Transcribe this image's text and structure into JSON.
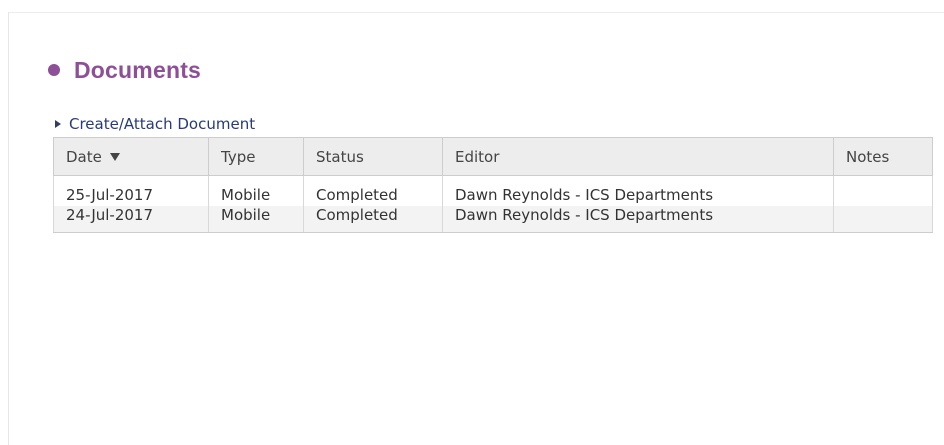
{
  "section": {
    "title": "Documents",
    "create_link": "Create/Attach Document"
  },
  "table": {
    "columns": {
      "date": "Date",
      "type": "Type",
      "status": "Status",
      "editor": "Editor",
      "notes": "Notes"
    },
    "sort": {
      "column": "date",
      "direction": "descending",
      "icon": "sort-down-icon"
    },
    "rows": [
      {
        "date": "25-Jul-2017",
        "type": "Mobile",
        "status": "Completed",
        "editor": "Dawn Reynolds - ICS Departments",
        "notes": ""
      },
      {
        "date": "24-Jul-2017",
        "type": "Mobile",
        "status": "Completed",
        "editor": "Dawn Reynolds - ICS Departments",
        "notes": ""
      }
    ]
  },
  "colors": {
    "heading": "#8e4f98",
    "link": "#283a7a",
    "header_bg": "#ededed",
    "alt_row_bg": "#f3f3f3"
  }
}
